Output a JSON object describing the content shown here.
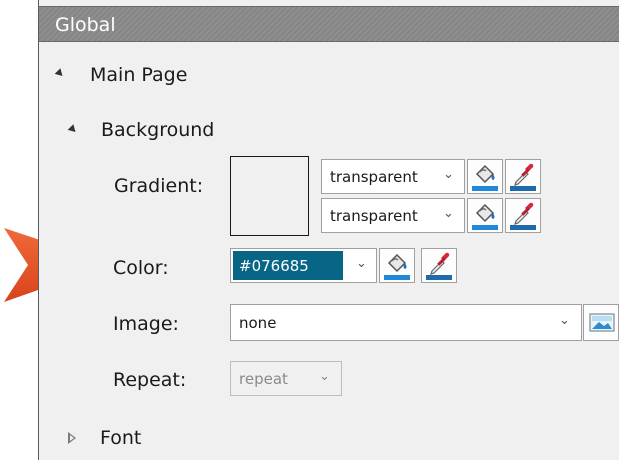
{
  "panel": {
    "title": "Global",
    "sections": {
      "main_page": "Main Page",
      "background": "Background",
      "font": "Font"
    }
  },
  "background": {
    "gradient_label": "Gradient:",
    "gradient_start": "transparent",
    "gradient_end": "transparent",
    "color_label": "Color:",
    "color_value": "#076685",
    "image_label": "Image:",
    "image_value": "none",
    "repeat_label": "Repeat:",
    "repeat_value": "repeat"
  },
  "colors": {
    "accent": "#076685",
    "callout_arrow": "#e8562a"
  },
  "icons": [
    "callout-arrow-icon",
    "expand-triangle-icon",
    "collapse-triangle-icon",
    "paint-bucket-icon",
    "eyedropper-icon",
    "image-picker-icon",
    "chevron-down-icon"
  ]
}
